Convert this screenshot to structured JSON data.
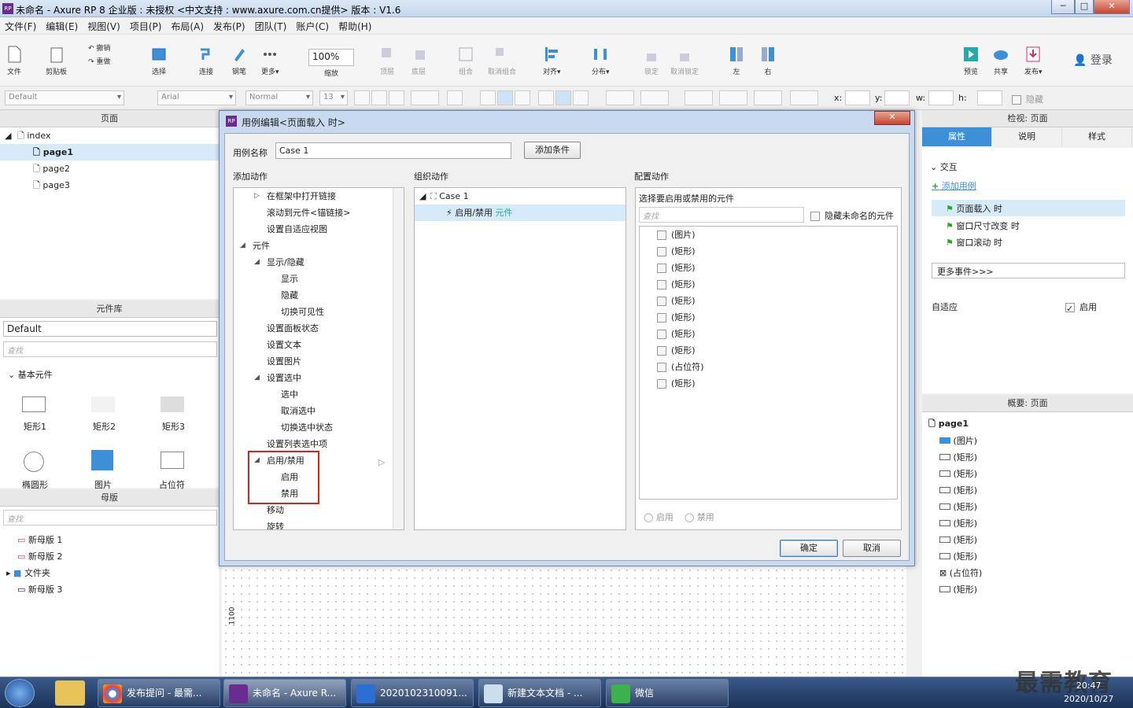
{
  "titlebar": {
    "title": "未命名 - Axure RP 8 企业版 : 未授权      <中文支持 : www.axure.com.cn提供> 版本 : V1.6",
    "logo": "RP",
    "min": "─",
    "max": "□",
    "close": "✕"
  },
  "menu": [
    "文件(F)",
    "编辑(E)",
    "视图(V)",
    "项目(P)",
    "布局(A)",
    "发布(P)",
    "团队(T)",
    "账户(C)",
    "帮助(H)"
  ],
  "toolbar": {
    "file": "文件",
    "clipboard": "剪贴板",
    "undo": "撤销",
    "redo": "重做",
    "select": "选择",
    "connect": "连接",
    "pen": "钢笔",
    "more": "更多▾",
    "zoom": "100%",
    "zoom_label": "缩放",
    "top": "顶层",
    "bottom": "底层",
    "group": "组合",
    "ungroup": "取消组合",
    "align": "对齐▾",
    "distribute": "分布▾",
    "lock": "锁定",
    "unlock": "取消锁定",
    "left": "左",
    "right": "右",
    "preview": "预览",
    "share": "共享",
    "publish": "发布▾",
    "login": "登录"
  },
  "toolbar2": {
    "style": "Default",
    "font": "Arial",
    "weight": "Normal",
    "size": "13",
    "x": "x:",
    "y": "y:",
    "w": "w:",
    "h": "h:",
    "hide": "隐藏"
  },
  "pages": {
    "title": "页面",
    "items": [
      "index",
      "page1",
      "page2",
      "page3"
    ]
  },
  "library": {
    "title": "元件库",
    "select": "Default",
    "search": "查找",
    "group": "基本元件",
    "widgets": [
      "矩形1",
      "矩形2",
      "矩形3",
      "椭圆形",
      "图片",
      "占位符"
    ]
  },
  "masters": {
    "title": "母版",
    "search": "查找",
    "items": [
      "新母版 1",
      "新母版 2",
      "文件夹",
      "新母版 3"
    ]
  },
  "inspector": {
    "title": "检视: 页面",
    "tabs": [
      "属性",
      "说明",
      "样式"
    ],
    "interaction": "交互",
    "add_case": "添加用例",
    "events": [
      "页面载入 时",
      "窗口尺寸改变 时",
      "窗口滚动 时"
    ],
    "more_events": "更多事件>>>",
    "adaptive": "自适应",
    "enable": "启用"
  },
  "outline": {
    "title": "概要: 页面",
    "root": "page1",
    "items": [
      "(图片)",
      "(矩形)",
      "(矩形)",
      "(矩形)",
      "(矩形)",
      "(矩形)",
      "(矩形)",
      "(矩形)",
      "(占位符)",
      "(矩形)"
    ]
  },
  "dialog": {
    "title": "用例编辑<页面载入 时>",
    "case_name_label": "用例名称",
    "case_name": "Case 1",
    "add_condition": "添加条件",
    "add_action": "添加动作",
    "organize": "组织动作",
    "configure": "配置动作",
    "actions": [
      "在框架中打开链接",
      "滚动到元件<锚链接>",
      "设置自适应视图",
      "元件",
      "显示/隐藏",
      "显示",
      "隐藏",
      "切换可见性",
      "设置面板状态",
      "设置文本",
      "设置图片",
      "设置选中",
      "选中",
      "取消选中",
      "切换选中状态",
      "设置列表选中项",
      "启用/禁用",
      "启用",
      "禁用",
      "移动",
      "旋转"
    ],
    "case_node": "Case 1",
    "action_node": "启用/禁用",
    "action_target": "元件",
    "select_prompt": "选择要启用或禁用的元件",
    "search": "查找",
    "hide_unnamed": "隐藏未命名的元件",
    "widgets": [
      "(图片)",
      "(矩形)",
      "(矩形)",
      "(矩形)",
      "(矩形)",
      "(矩形)",
      "(矩形)",
      "(矩形)",
      "(占位符)",
      "(矩形)"
    ],
    "radio_enable": "启用",
    "radio_disable": "禁用",
    "ok": "确定",
    "cancel": "取消"
  },
  "canvas": {
    "ruler": "1100"
  },
  "taskbar": {
    "items": [
      "发布提问 - 最需...",
      "未命名 - Axure R...",
      "2020102310091...",
      "新建文本文档 - ...",
      "微信"
    ],
    "time": "20:47",
    "date": "2020/10/27",
    "watermark": "最需教育"
  },
  "colors": {
    "accent": "#3d8fd6",
    "highlight": "#d6eaf8",
    "red": "#e02020"
  }
}
